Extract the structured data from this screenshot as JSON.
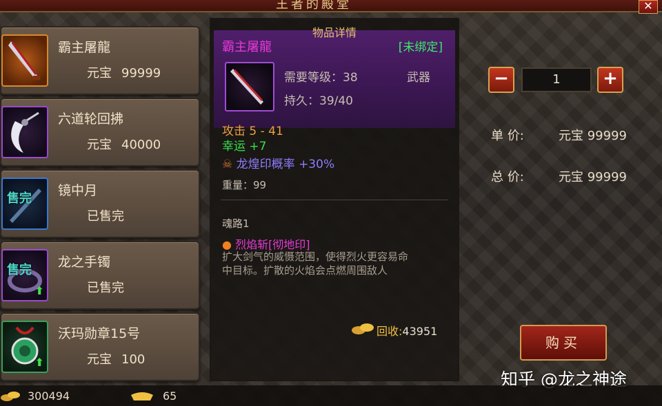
{
  "window": {
    "title": "王者的殿堂"
  },
  "items": [
    {
      "name": "霸主屠龍",
      "price_label": "元宝",
      "price_value": "99999",
      "sold": false,
      "frame": "orange"
    },
    {
      "name": "六道轮回拂",
      "price_label": "元宝",
      "price_value": "40000",
      "sold": false,
      "frame": "purple"
    },
    {
      "name": "镜中月",
      "status": "已售完",
      "sold": true,
      "sold_tag": "售完",
      "frame": "blue"
    },
    {
      "name": "龙之手镯",
      "status": "已售完",
      "sold": true,
      "sold_tag": "售完",
      "frame": "purple"
    },
    {
      "name": "沃玛勋章15号",
      "price_label": "元宝",
      "price_value": "100",
      "sold": false,
      "frame": "green"
    }
  ],
  "detail": {
    "panel_title": "物品详情",
    "name": "霸主屠龍",
    "bind_status": "[未绑定]",
    "level_req": "需要等级：38",
    "type": "武器",
    "durability": "持久：39/40",
    "attack": "攻击 5 - 41",
    "luck_label": "幸运",
    "luck_value": "+7",
    "seal_label": "龙煌印概率",
    "seal_value": "+30%",
    "weight": "重量：99",
    "soul_title": "魂路1",
    "skill_name": "烈焰斩[彻地印]",
    "skill_desc_1": "扩大剑气的威慑范围，使得烈火更容易命",
    "skill_desc_2": "中目标。扩散的火焰会点燃周围敌人",
    "recycle_label": "回收:",
    "recycle_value": "43951"
  },
  "purchase": {
    "minus": "−",
    "plus": "+",
    "quantity": "1",
    "unit_label": "单 价:",
    "unit_currency": "元宝",
    "unit_value": "99999",
    "total_label": "总 价:",
    "total_currency": "元宝",
    "total_value": "99999",
    "buy_label": "购买"
  },
  "currency": {
    "gold": "300494",
    "ingot": "65"
  },
  "watermark": "知乎 @龙之神途",
  "colors": {
    "purple_name": "#e83ad8",
    "green_bind": "#3ee86a",
    "accent_gold": "#e6c070"
  }
}
